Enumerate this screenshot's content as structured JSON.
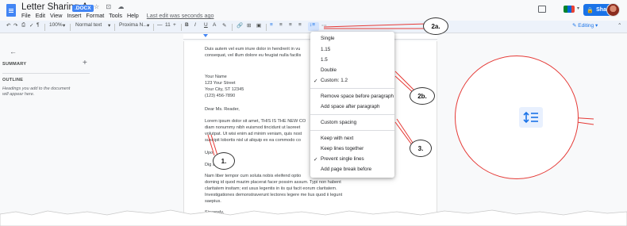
{
  "titlebar": {
    "doc_title": "Letter Sharing-A",
    "badge": ".DOCX",
    "title_icons": "☆ ⊡ ☁",
    "menu": [
      "File",
      "Edit",
      "View",
      "Insert",
      "Format",
      "Tools",
      "Help"
    ],
    "last_edit": "Last edit was seconds ago",
    "share_label": "Share"
  },
  "toolbar": {
    "zoom": "100%",
    "style": "Normal text",
    "font": "Proxima N...",
    "size": "11",
    "bold": "B",
    "italic": "I",
    "underline": "U",
    "text_color": "A",
    "editing_label": "Editing"
  },
  "left_panel": {
    "summary_label": "SUMMARY",
    "outline_label": "OUTLINE",
    "outline_hint": "Headings you add to the document will appear here."
  },
  "document": {
    "lines": [
      "Duis autem vel eum iriure dolor in hendrerit in vu",
      "consequat, vel illum dolore eu feugiat nulla facilis",
      "",
      "Your Name",
      "123 Your Street",
      "Your City, ST 12345",
      "(123) 456-7890",
      "",
      "Dear Ms. Reader,",
      "",
      "Lorem ipsum dolor sit amet, THIS IS THE NEW CO",
      "diam nonummy nibh euismod tincidunt ut laoreet",
      "volutpat. Ut wisi enim ad minim veniam, quis nost",
      "suscipit lobortis nisl ut aliquip ex ea commodo co",
      "",
      "Upo",
      "",
      "Dig                 ader",
      "",
      "Nam liber tempor cum soluta nobis eleifend optio",
      "doming id quod mazim placerat facer possim assum. Typi non habent",
      "claritatem insitam; est usus legentis in iis qui facit eorum claritatem.",
      "Investigationes demonstraverunt lectores legere me lius quod ii legunt",
      "saepius.",
      "",
      "Sincerely,"
    ]
  },
  "line_spacing_menu": {
    "group1": [
      "Single",
      "1.15",
      "1.5",
      "Double",
      "Custom: 1.2"
    ],
    "checked_item": "Custom: 1.2",
    "group2": [
      "Remove space before paragraph",
      "Add space after paragraph"
    ],
    "group3": [
      "Custom spacing"
    ],
    "group4": [
      "Keep with next",
      "Keep lines together",
      "Prevent single lines",
      "Add page break before"
    ],
    "checked_item_2": "Prevent single lines"
  },
  "callouts": {
    "c1": "1.",
    "c2a": "2a.",
    "c2b": "2b.",
    "c3": "3."
  },
  "colors": {
    "accent": "#1a73e8",
    "callout_line": "#e53935",
    "doc_blue": "#4285f4"
  }
}
